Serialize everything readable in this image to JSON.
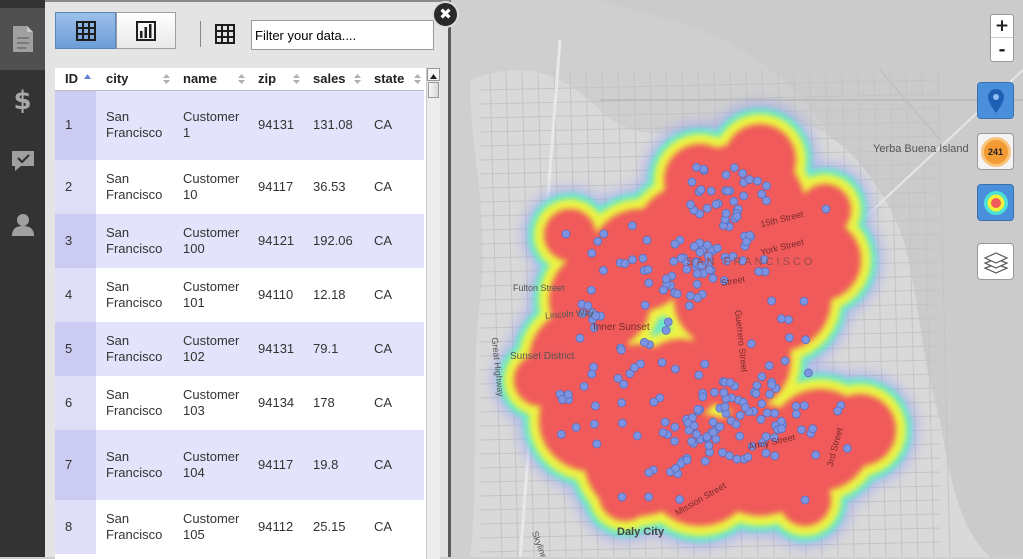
{
  "sidebar": {
    "items": [
      {
        "name": "documents",
        "icon": "document-icon",
        "active": true
      },
      {
        "name": "finance",
        "icon": "dollar-icon",
        "active": false
      },
      {
        "name": "messages",
        "icon": "chat-icon",
        "active": false
      },
      {
        "name": "profile",
        "icon": "user-icon",
        "active": false
      }
    ],
    "dollar_glyph": "$"
  },
  "toolbar": {
    "grid_view_icon": "grid-icon",
    "chart_view_icon": "bar-chart-icon",
    "grid_icon": "grid-icon",
    "filter_placeholder": "Filter your data....",
    "close_glyph": "✖"
  },
  "table": {
    "columns": [
      "ID",
      "city",
      "name",
      "zip",
      "sales",
      "state"
    ],
    "sorted_column": "ID",
    "rows": [
      {
        "id": "1",
        "city": "San Francisco",
        "name": "Customer 1",
        "zip": "94131",
        "sales": "131.08",
        "state": "CA"
      },
      {
        "id": "2",
        "city": "San Francisco",
        "name": "Customer 10",
        "zip": "94117",
        "sales": "36.53",
        "state": "CA"
      },
      {
        "id": "3",
        "city": "San Francisco",
        "name": "Customer 100",
        "zip": "94121",
        "sales": "192.06",
        "state": "CA"
      },
      {
        "id": "4",
        "city": "San Francisco",
        "name": "Customer 101",
        "zip": "94110",
        "sales": "12.18",
        "state": "CA"
      },
      {
        "id": "5",
        "city": "San Francisco",
        "name": "Customer 102",
        "zip": "94131",
        "sales": "79.1",
        "state": "CA"
      },
      {
        "id": "6",
        "city": "San Francisco",
        "name": "Customer 103",
        "zip": "94134",
        "sales": "178",
        "state": "CA"
      },
      {
        "id": "7",
        "city": "San Francisco",
        "name": "Customer 104",
        "zip": "94117",
        "sales": "19.8",
        "state": "CA"
      },
      {
        "id": "8",
        "city": "San Francisco",
        "name": "Customer 105",
        "zip": "94112",
        "sales": "25.15",
        "state": "CA"
      }
    ]
  },
  "map": {
    "zoom_in": "+",
    "zoom_out": "-",
    "tools": {
      "markers": "map-marker-icon",
      "cluster": "cluster-icon",
      "cluster_count": "241",
      "heatmap": "heatmap-icon",
      "layers": "layers-icon"
    },
    "labels": {
      "yerba_buena": "Yerba Buena Island",
      "fulton": "Fulton Street",
      "lincoln": "Lincoln Way",
      "great_highway": "Great Highway",
      "sunset": "Sunset District",
      "inner_sunset": "Inner Sunset",
      "guerrero": "Guerrero Street",
      "cesar": "Cesar Chavez",
      "army": "Army Street",
      "third": "3rd Street",
      "mission": "Mission Street",
      "daly": "Daly City",
      "skyline": "Skyline",
      "sf": "SAN FRANCISCO",
      "fifteenth": "15th Street",
      "york": "York Street",
      "street": "Street"
    },
    "colors": {
      "heat_high": "#f05a5a",
      "heat_mid": "#f4f43a",
      "heat_low": "#5af0c8",
      "point": "#7b93e0",
      "accent": "#4a8fdb"
    }
  }
}
